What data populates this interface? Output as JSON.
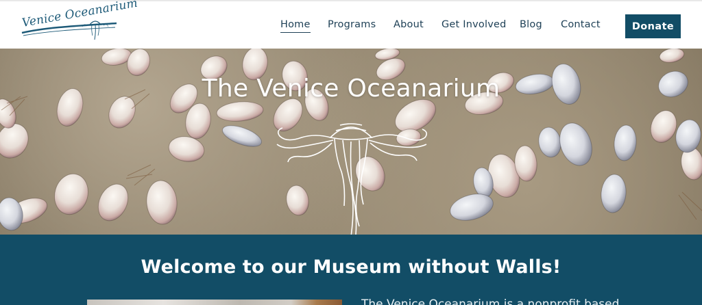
{
  "header": {
    "logo_text": "Venice Oceanarium",
    "logo_icon": "jellyfish-icon",
    "nav": [
      {
        "label": "Home",
        "active": true
      },
      {
        "label": "Programs",
        "active": false
      },
      {
        "label": "About",
        "active": false
      },
      {
        "label": "Get Involved",
        "active": false
      },
      {
        "label": "Blog",
        "active": false
      },
      {
        "label": "Contact",
        "active": false
      }
    ],
    "donate_label": "Donate"
  },
  "hero": {
    "title": "The Venice Oceanarium",
    "emblem_icon": "jellyfish-icon",
    "background": "seashells-on-sand"
  },
  "welcome": {
    "title": "Welcome to our Museum without Walls!",
    "paragraph_start": "The Venice Oceanarium is a nonprofit based"
  },
  "colors": {
    "brand_primary": "#124d66",
    "nav_text": "#1d3f55",
    "logo_text": "#1d5a78",
    "white": "#ffffff"
  }
}
